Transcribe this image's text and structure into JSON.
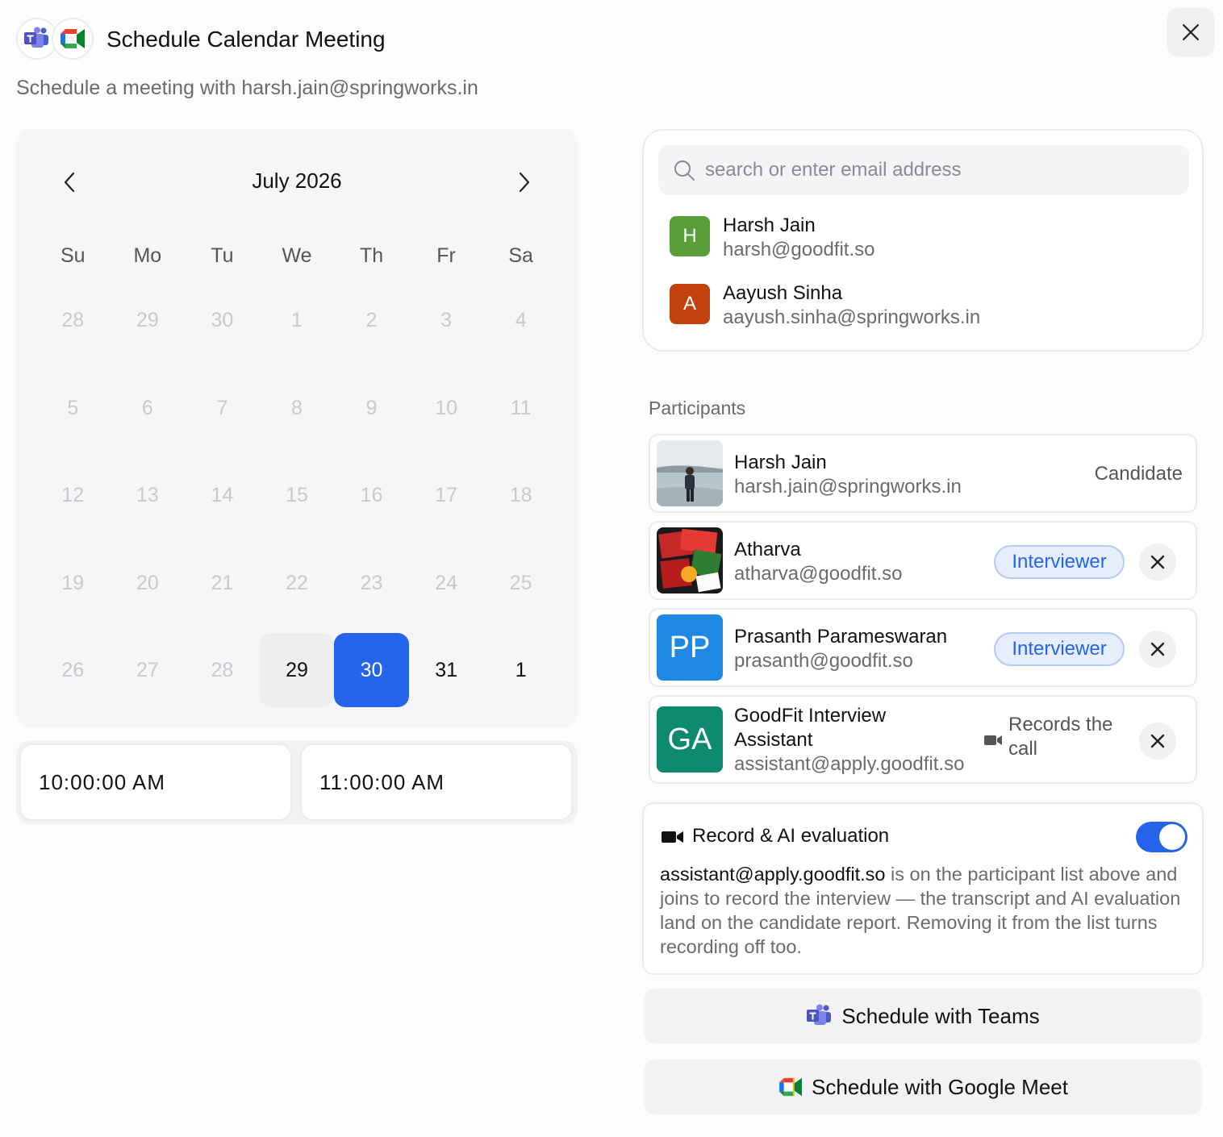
{
  "header": {
    "title": "Schedule Calendar Meeting",
    "subtitle": "Schedule a meeting with harsh.jain@springworks.in"
  },
  "calendar": {
    "month_label": "July 2026",
    "weekdays": [
      "Su",
      "Mo",
      "Tu",
      "We",
      "Th",
      "Fr",
      "Sa"
    ],
    "weeks": [
      [
        "28",
        "29",
        "30",
        "1",
        "2",
        "3",
        "4"
      ],
      [
        "5",
        "6",
        "7",
        "8",
        "9",
        "10",
        "11"
      ],
      [
        "12",
        "13",
        "14",
        "15",
        "16",
        "17",
        "18"
      ],
      [
        "19",
        "20",
        "21",
        "22",
        "23",
        "24",
        "25"
      ],
      [
        "26",
        "27",
        "28",
        "29",
        "30",
        "31",
        "1"
      ]
    ],
    "today": "29",
    "selected": "30"
  },
  "time": {
    "start": "10:00:00 AM",
    "end": "11:00:00 AM"
  },
  "search": {
    "placeholder": "search or enter email address",
    "suggestions": [
      {
        "initial": "H",
        "name": "Harsh Jain",
        "email": "harsh@goodfit.so",
        "color": "#5a9e3a"
      },
      {
        "initial": "A",
        "name": "Aayush Sinha",
        "email": "aayush.sinha@springworks.in",
        "color": "#c2410c"
      }
    ]
  },
  "participants": {
    "label": "Participants",
    "items": [
      {
        "name": "Harsh Jain",
        "email": "harsh.jain@springworks.in",
        "role": "Candidate"
      },
      {
        "name": "Atharva",
        "email": "atharva@goodfit.so",
        "role": "Interviewer"
      },
      {
        "initials": "PP",
        "name": "Prasanth Parameswaran",
        "email": "prasanth@goodfit.so",
        "role": "Interviewer",
        "color": "#1e88e5"
      },
      {
        "initials": "GA",
        "name_line1": "GoodFit Interview",
        "name_line2": "Assistant",
        "email": "assistant@apply.goodfit.so",
        "note": "Records the call",
        "color": "#0b8a6f"
      }
    ]
  },
  "record": {
    "title": "Record & AI evaluation",
    "enabled": true,
    "email": "assistant@apply.goodfit.so",
    "description": " is on the participant list above and joins to record the interview — the transcript and AI evaluation land on the candidate report. Removing it from the list turns recording off too."
  },
  "actions": {
    "teams": "Schedule with Teams",
    "meet": "Schedule with Google Meet"
  },
  "colors": {
    "accent": "#2563eb",
    "teams": "#5059c9",
    "badge_bg": "#e6eefc"
  }
}
